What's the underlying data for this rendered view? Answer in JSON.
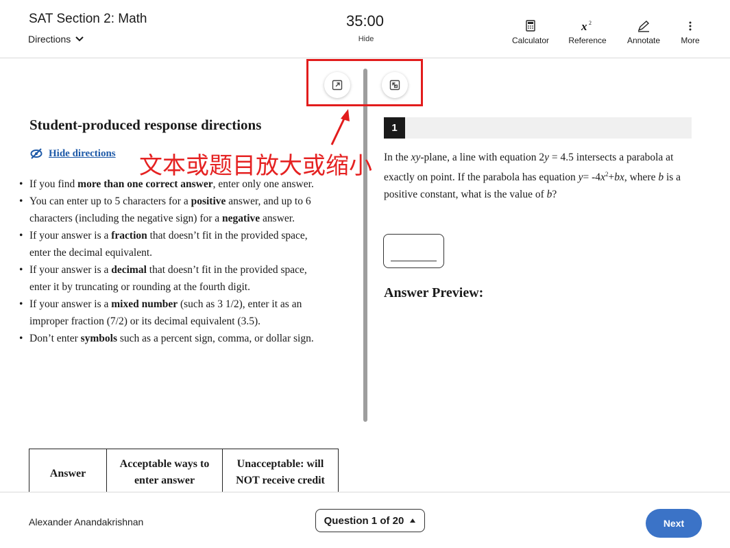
{
  "header": {
    "section_title": "SAT Section 2: Math",
    "directions_label": "Directions",
    "timer": "35:00",
    "timer_hide": "Hide",
    "tools": [
      {
        "label": "Calculator",
        "icon": "calculator-icon"
      },
      {
        "label": "Reference",
        "icon": "reference-formula-icon"
      },
      {
        "label": "Annotate",
        "icon": "pencil-icon"
      },
      {
        "label": "More",
        "icon": "more-vertical-icon"
      }
    ]
  },
  "annotation": {
    "note": "文本或题目放大或缩小",
    "color": "#e21c1c"
  },
  "directions": {
    "title": "Student-produced response directions",
    "hide_label": "Hide directions"
  },
  "table": {
    "headers": [
      "Answer",
      "Acceptable ways to enter answer",
      "Unacceptable: will NOT receive credit"
    ]
  },
  "question": {
    "number": "1",
    "answer_preview_label": "Answer Preview:"
  },
  "footer": {
    "student_name": "Alexander Anandakrishnan",
    "question_nav": "Question 1 of 20",
    "next_label": "Next"
  },
  "colors": {
    "accent_blue": "#3b73c7",
    "link_blue": "#1e5aa8"
  }
}
